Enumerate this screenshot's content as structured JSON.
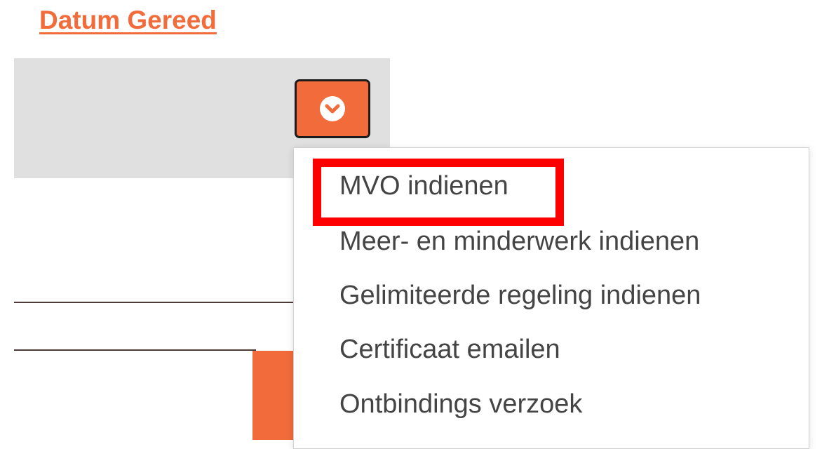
{
  "header": {
    "sort_link_label": "Datum Gereed"
  },
  "actions": {
    "button_icon": "chevron-down-circle-icon",
    "button_color": "#f26b3a"
  },
  "dropdown": {
    "items": [
      {
        "label": "MVO indienen"
      },
      {
        "label": "Meer- en minderwerk indienen"
      },
      {
        "label": "Gelimiteerde regeling indienen"
      },
      {
        "label": "Certificaat emailen"
      },
      {
        "label": "Ontbindings verzoek"
      }
    ],
    "highlighted_index": 0,
    "highlight_color": "#ff0000"
  },
  "colors": {
    "accent": "#f26b3a",
    "panel": "#e0e0e0",
    "menu_text": "#444444"
  }
}
